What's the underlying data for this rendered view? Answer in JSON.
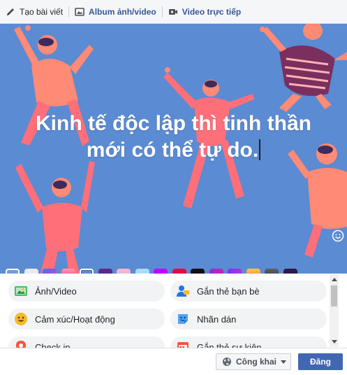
{
  "tabs": [
    {
      "label": "Tạo bài viết",
      "icon": "pencil-icon"
    },
    {
      "label": "Album ảnh/video",
      "icon": "photo-album-icon"
    },
    {
      "label": "Video trực tiếp",
      "icon": "live-video-icon"
    }
  ],
  "composer": {
    "line1": "Kinh tế độc lập thì tinh thần",
    "line2": "mới có thể tự do.",
    "background_color": "#5b8bd2",
    "text_color": "#ffffff",
    "emoji_button_icon": "smiley-icon"
  },
  "backgrounds": {
    "back_icon": "chevron-left-icon",
    "swatches": [
      {
        "name": "white",
        "color": "#e9ebee"
      },
      {
        "name": "rainbow",
        "color": "linear-gradient(135deg,#2e7df6,#9d4edd,#ff6fa1)"
      },
      {
        "name": "pink-red",
        "color": "linear-gradient(180deg,#ff9bb0,#e5196a)"
      },
      {
        "name": "people-illustration",
        "color": "#5b8bd2",
        "selected": true
      },
      {
        "name": "purple-pattern",
        "color": "#5a2a82"
      },
      {
        "name": "pastel-stripes",
        "color": "linear-gradient(180deg,#ffb3c7,#a7c8ff)"
      },
      {
        "name": "light-blue",
        "color": "#a8ddf7"
      },
      {
        "name": "violet",
        "color": "#c000ff"
      },
      {
        "name": "crimson",
        "color": "#e20a44"
      },
      {
        "name": "black",
        "color": "#111111"
      },
      {
        "name": "magenta-purple",
        "color": "linear-gradient(135deg,#8e2de2,#e0208a)"
      },
      {
        "name": "purple-gradient",
        "color": "linear-gradient(135deg,#7b2ff7,#c43ad6)"
      },
      {
        "name": "orange-pink",
        "color": "linear-gradient(180deg,#ffcf3a,#ff3d77)"
      },
      {
        "name": "dark-gray",
        "color": "linear-gradient(180deg,#5d6163,#2a2c2e)"
      },
      {
        "name": "galaxy",
        "color": "#2b1a4a"
      }
    ]
  },
  "options": [
    {
      "label": "Ảnh/Video",
      "icon": "photo-video-icon"
    },
    {
      "label": "Gắn thẻ bạn bè",
      "icon": "tag-friends-icon"
    },
    {
      "label": "Cảm xúc/Hoạt động",
      "icon": "feeling-emoji-icon"
    },
    {
      "label": "Nhãn dán",
      "icon": "sticker-icon"
    },
    {
      "label": "Check in",
      "icon": "location-pin-icon"
    },
    {
      "label": "Gắn thẻ sự kiện",
      "icon": "event-icon"
    }
  ],
  "footer": {
    "privacy_label": "Công khai",
    "privacy_icon": "globe-icon",
    "post_label": "Đăng",
    "accent": "#4267b2"
  }
}
